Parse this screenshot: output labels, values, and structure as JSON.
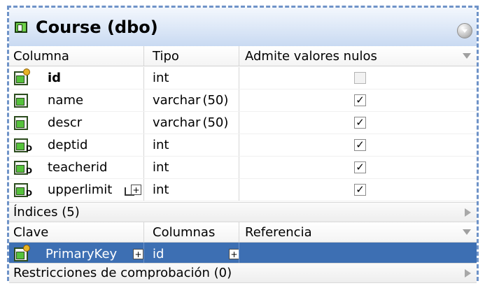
{
  "table": {
    "title": "Course (dbo)",
    "columns_header": {
      "col1": "Columna",
      "col2": "Tipo",
      "col3": "Admite valores nulos"
    },
    "rows": [
      {
        "name": "id",
        "type": "int",
        "nullable": false,
        "icon": "primary-key-column-icon"
      },
      {
        "name": "name",
        "type": "varchar",
        "size": "(50)",
        "nullable": true,
        "icon": "column-icon"
      },
      {
        "name": "descr",
        "type": "varchar",
        "size": "(50)",
        "nullable": true,
        "icon": "column-icon"
      },
      {
        "name": "deptid",
        "type": "int",
        "nullable": true,
        "icon": "foreign-key-column-icon"
      },
      {
        "name": "teacherid",
        "type": "int",
        "nullable": true,
        "icon": "foreign-key-column-icon"
      },
      {
        "name": "upperlimit",
        "type": "int",
        "nullable": true,
        "icon": "foreign-key-column-icon"
      }
    ],
    "indexes": {
      "title": "Índices (5)",
      "header": {
        "col1": "Clave",
        "col2": "Columnas",
        "col3": "Referencia"
      },
      "selected_row": {
        "key": "PrimaryKey",
        "columns": "id",
        "reference": ""
      }
    },
    "check_constraints": "Restricciones de comprobación (0)"
  },
  "colors": {
    "selection": "#3d6fb3",
    "title_gradient_bottom": "#c9daf2",
    "dashed_border": "#6f93c8"
  }
}
